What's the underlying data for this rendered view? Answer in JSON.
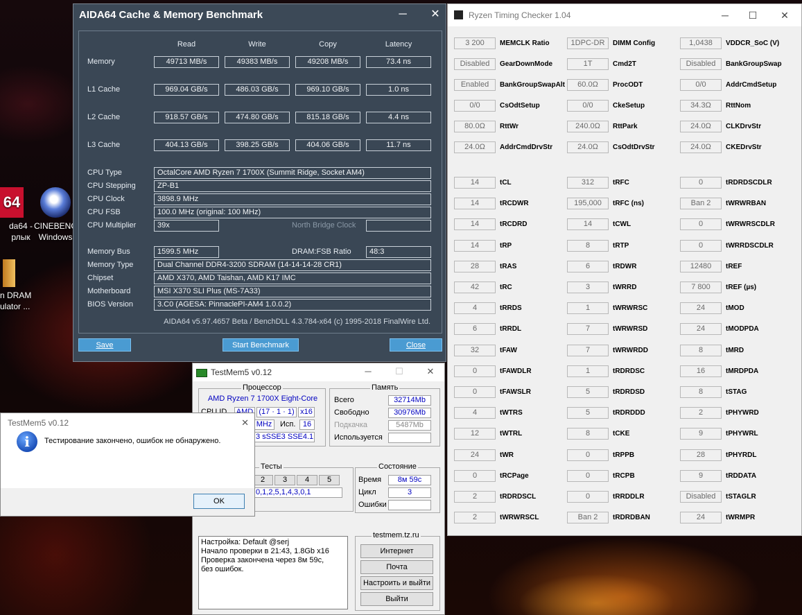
{
  "desktop": {
    "icons": [
      {
        "line1": "da64 -",
        "line2": "рлык"
      },
      {
        "line1": "CINEBENC",
        "line2": "Windows"
      },
      {
        "line1": "n DRAM",
        "line2": "ulator ..."
      }
    ]
  },
  "aida": {
    "title": "AIDA64 Cache & Memory Benchmark",
    "minimize": "─",
    "close": "✕",
    "headers": [
      "Read",
      "Write",
      "Copy",
      "Latency"
    ],
    "rows": [
      {
        "label": "Memory",
        "values": [
          "49713 MB/s",
          "49383 MB/s",
          "49208 MB/s",
          "73.4 ns"
        ]
      },
      {
        "label": "L1 Cache",
        "values": [
          "969.04 GB/s",
          "486.03 GB/s",
          "969.10 GB/s",
          "1.0 ns"
        ]
      },
      {
        "label": "L2 Cache",
        "values": [
          "918.57 GB/s",
          "474.80 GB/s",
          "815.18 GB/s",
          "4.4 ns"
        ]
      },
      {
        "label": "L3 Cache",
        "values": [
          "404.13 GB/s",
          "398.25 GB/s",
          "404.06 GB/s",
          "11.7 ns"
        ]
      }
    ],
    "cpu_type_label": "CPU Type",
    "cpu_type": "OctalCore AMD Ryzen 7 1700X  (Summit Ridge, Socket AM4)",
    "cpu_stepping_label": "CPU Stepping",
    "cpu_stepping": "ZP-B1",
    "cpu_clock_label": "CPU Clock",
    "cpu_clock": "3898.9 MHz",
    "cpu_fsb_label": "CPU FSB",
    "cpu_fsb": "100.0 MHz  (original: 100 MHz)",
    "cpu_mult_label": "CPU Multiplier",
    "cpu_mult": "39x",
    "nb_clock_label": "North Bridge Clock",
    "nb_clock": "",
    "mem_bus_label": "Memory Bus",
    "mem_bus": "1599.5 MHz",
    "dram_fsb_label": "DRAM:FSB Ratio",
    "dram_fsb": "48:3",
    "mem_type_label": "Memory Type",
    "mem_type": "Dual Channel DDR4-3200 SDRAM  (14-14-14-28 CR1)",
    "chipset_label": "Chipset",
    "chipset": "AMD X370, AMD Taishan, AMD K17 IMC",
    "mobo_label": "Motherboard",
    "mobo": "MSI X370 SLI Plus (MS-7A33)",
    "bios_label": "BIOS Version",
    "bios": "3.C0  (AGESA: PinnaclePI-AM4 1.0.0.2)",
    "footer": "AIDA64 v5.97.4657 Beta / BenchDLL 4.3.784-x64  (c) 1995-2018 FinalWire Ltd.",
    "save": "Save",
    "start": "Start Benchmark",
    "close_btn": "Close"
  },
  "rtc": {
    "title": "Ryzen Timing Checker 1.04",
    "minimize": "─",
    "maximize": "☐",
    "close": "✕",
    "cols": [
      [
        {
          "v": "3 200",
          "l": "MEMCLK Ratio"
        },
        {
          "v": "Disabled",
          "l": "GearDownMode"
        },
        {
          "v": "Enabled",
          "l": "BankGroupSwapAlt"
        },
        {
          "v": "0/0",
          "l": "CsOdtSetup"
        },
        {
          "v": "80.0Ω",
          "l": "RttWr"
        },
        {
          "v": "24.0Ω",
          "l": "AddrCmdDrvStr"
        },
        {
          "v": "14",
          "l": "tCL"
        },
        {
          "v": "14",
          "l": "tRCDWR"
        },
        {
          "v": "14",
          "l": "tRCDRD"
        },
        {
          "v": "14",
          "l": "tRP"
        },
        {
          "v": "28",
          "l": "tRAS"
        },
        {
          "v": "42",
          "l": "tRC"
        },
        {
          "v": "4",
          "l": "tRRDS"
        },
        {
          "v": "6",
          "l": "tRRDL"
        },
        {
          "v": "32",
          "l": "tFAW"
        },
        {
          "v": "0",
          "l": "tFAWDLR"
        },
        {
          "v": "0",
          "l": "tFAWSLR"
        },
        {
          "v": "4",
          "l": "tWTRS"
        },
        {
          "v": "12",
          "l": "tWTRL"
        },
        {
          "v": "24",
          "l": "tWR"
        },
        {
          "v": "0",
          "l": "tRCPage"
        },
        {
          "v": "2",
          "l": "tRDRDSCL"
        },
        {
          "v": "2",
          "l": "tWRWRSCL"
        }
      ],
      [
        {
          "v": "1DPC-DR",
          "l": "DIMM Config"
        },
        {
          "v": "1T",
          "l": "Cmd2T"
        },
        {
          "v": "60.0Ω",
          "l": "ProcODT"
        },
        {
          "v": "0/0",
          "l": "CkeSetup"
        },
        {
          "v": "240.0Ω",
          "l": "RttPark"
        },
        {
          "v": "24.0Ω",
          "l": "CsOdtDrvStr"
        },
        {
          "v": "312",
          "l": "tRFC"
        },
        {
          "v": "195,000",
          "l": "tRFC (ns)"
        },
        {
          "v": "14",
          "l": "tCWL"
        },
        {
          "v": "8",
          "l": "tRTP"
        },
        {
          "v": "6",
          "l": "tRDWR"
        },
        {
          "v": "3",
          "l": "tWRRD"
        },
        {
          "v": "1",
          "l": "tWRWRSC"
        },
        {
          "v": "7",
          "l": "tWRWRSD"
        },
        {
          "v": "7",
          "l": "tWRWRDD"
        },
        {
          "v": "1",
          "l": "tRDRDSC"
        },
        {
          "v": "5",
          "l": "tRDRDSD"
        },
        {
          "v": "5",
          "l": "tRDRDDD"
        },
        {
          "v": "8",
          "l": "tCKE"
        },
        {
          "v": "0",
          "l": "tRPPB"
        },
        {
          "v": "0",
          "l": "tRCPB"
        },
        {
          "v": "0",
          "l": "tRRDDLR"
        },
        {
          "v": "Ban 2",
          "l": "tRDRDBAN"
        }
      ],
      [
        {
          "v": "1,0438",
          "l": "VDDCR_SoC (V)"
        },
        {
          "v": "Disabled",
          "l": "BankGroupSwap"
        },
        {
          "v": "0/0",
          "l": "AddrCmdSetup"
        },
        {
          "v": "34.3Ω",
          "l": "RttNom"
        },
        {
          "v": "24.0Ω",
          "l": "CLKDrvStr"
        },
        {
          "v": "24.0Ω",
          "l": "CKEDrvStr"
        },
        {
          "v": "0",
          "l": "tRDRDSCDLR"
        },
        {
          "v": "Ban 2",
          "l": "tWRWRBAN"
        },
        {
          "v": "0",
          "l": "tWRWRSCDLR"
        },
        {
          "v": "0",
          "l": "tWRRDSCDLR"
        },
        {
          "v": "12480",
          "l": "tREF"
        },
        {
          "v": "7 800",
          "l": "tREF (µs)"
        },
        {
          "v": "24",
          "l": "tMOD"
        },
        {
          "v": "24",
          "l": "tMODPDA"
        },
        {
          "v": "8",
          "l": "tMRD"
        },
        {
          "v": "16",
          "l": "tMRDPDA"
        },
        {
          "v": "8",
          "l": "tSTAG"
        },
        {
          "v": "2",
          "l": "tPHYWRD"
        },
        {
          "v": "9",
          "l": "tPHYWRL"
        },
        {
          "v": "28",
          "l": "tPHYRDL"
        },
        {
          "v": "9",
          "l": "tRDDATA"
        },
        {
          "v": "Disabled",
          "l": "tSTAGLR"
        },
        {
          "v": "24",
          "l": "tWRMPR"
        }
      ]
    ]
  },
  "testmem": {
    "title": "TestMem5 v0.12",
    "minimize": "─",
    "maximize": "☐",
    "close": "✕",
    "cpu_group": "Процессор",
    "cpu_name": "AMD Ryzen 7 1700X Eight-Core",
    "cpuid_label": "CPU ID",
    "cpuid_vendor": "AMD",
    "cpuid_family": "(17 · 1 · 1)",
    "cpuid_threads": "x16",
    "freq_unit": "MHz",
    "used_label": "Исп.",
    "used_val": "16",
    "isa": "3 sSSE3 SSE4.1",
    "mem_group": "Память",
    "total_label": "Всего",
    "total": "32714Mb",
    "free_label": "Свободно",
    "free": "30976Mb",
    "swap_label": "Подкачка",
    "swap": "5487Mb",
    "inuse_label": "Используется",
    "inuse": "",
    "tests_group": "Тесты",
    "tests": [
      "2",
      "3",
      "4",
      "5"
    ],
    "test_seq": "0,1,2,5,1,4,3,0,1",
    "state_group": "Состояние",
    "time_label": "Время",
    "time": "8м 59с",
    "cycle_label": "Цикл",
    "cycle": "3",
    "errors_label": "Ошибки",
    "errors": "",
    "log": [
      "Настройка: Default @serj",
      "Начало проверки в 21:43, 1.8Gb x16",
      "Проверка закончена через 8м 59с,",
      "без ошибок."
    ],
    "site_group": "testmem.tz.ru",
    "btn_internet": "Интернет",
    "btn_mail": "Почта",
    "btn_config": "Настроить и выйти",
    "btn_exit": "Выйти"
  },
  "msgbox": {
    "title": "TestMem5 v0.12",
    "close": "✕",
    "text": "Тестирование закончено, ошибок не обнаружено.",
    "ok": "OK"
  }
}
